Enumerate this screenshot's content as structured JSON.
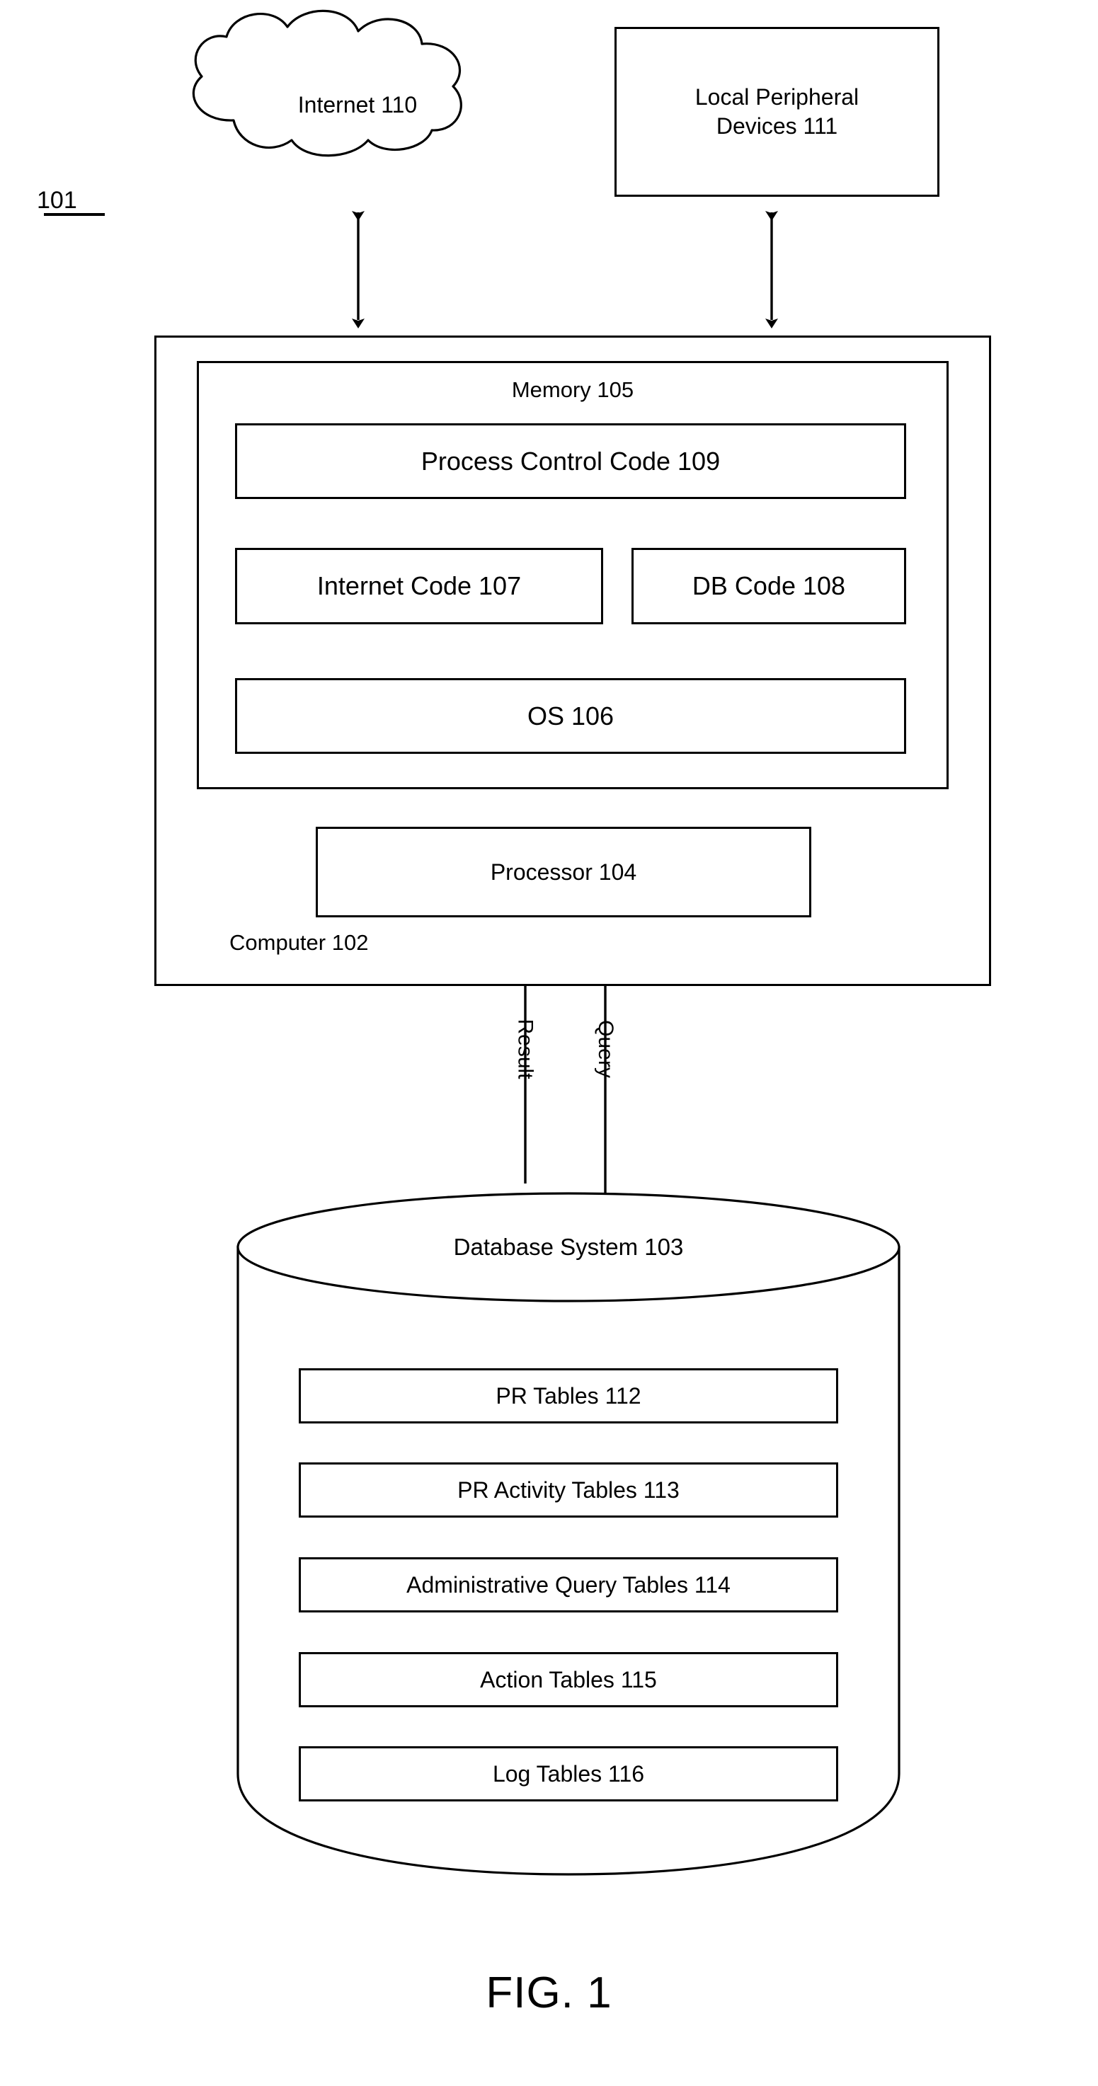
{
  "figure": {
    "caption": "FIG. 1",
    "system_ref": "101"
  },
  "nodes": {
    "internet": {
      "label": "Internet 110",
      "shape": "cloud"
    },
    "peripherals": {
      "label_line1": "Local Peripheral",
      "label_line2": "Devices 111",
      "shape": "rect"
    },
    "computer": {
      "label": "Computer 102",
      "shape": "rect"
    },
    "memory": {
      "label": "Memory 105",
      "shape": "rect"
    },
    "process_control_code": {
      "label": "Process Control Code 109",
      "shape": "rect"
    },
    "internet_code": {
      "label": "Internet Code 107",
      "shape": "rect"
    },
    "db_code": {
      "label": "DB Code 108",
      "shape": "rect"
    },
    "os": {
      "label": "OS 106",
      "shape": "rect"
    },
    "processor": {
      "label": "Processor 104",
      "shape": "rect"
    },
    "database_system": {
      "label": "Database System 103",
      "shape": "cylinder"
    }
  },
  "db_tables": [
    {
      "label": "PR Tables 112"
    },
    {
      "label": "PR Activity Tables 113"
    },
    {
      "label": "Administrative Query Tables 114"
    },
    {
      "label": "Action Tables 115"
    },
    {
      "label": "Log Tables 116"
    }
  ],
  "connectors": [
    {
      "label": "",
      "from": "internet",
      "to": "computer",
      "style": "double-arrow"
    },
    {
      "label": "",
      "from": "peripherals",
      "to": "computer",
      "style": "double-arrow"
    },
    {
      "label": "Result",
      "from": "database_system",
      "to": "processor",
      "style": "arrow-up"
    },
    {
      "label": "Query",
      "from": "processor",
      "to": "database_system",
      "style": "arrow-down"
    }
  ],
  "colors": {
    "stroke": "#000000",
    "fill": "#ffffff"
  }
}
